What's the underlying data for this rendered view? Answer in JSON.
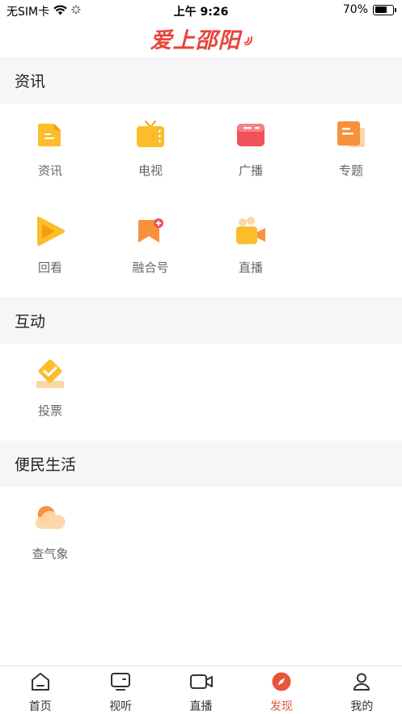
{
  "status_bar": {
    "carrier": "无SIM卡",
    "time": "上午 9:26",
    "battery_text": "70%",
    "battery_level": 0.7
  },
  "header": {
    "logo_text": "爱上邵阳"
  },
  "sections": {
    "news": {
      "title": "资讯",
      "items": [
        {
          "label": "资讯",
          "icon": "news-doc-icon"
        },
        {
          "label": "电视",
          "icon": "tv-icon"
        },
        {
          "label": "广播",
          "icon": "radio-icon"
        },
        {
          "label": "专题",
          "icon": "topic-icon"
        },
        {
          "label": "回看",
          "icon": "playback-icon"
        },
        {
          "label": "融合号",
          "icon": "media-account-icon"
        },
        {
          "label": "直播",
          "icon": "live-camera-icon"
        }
      ]
    },
    "interact": {
      "title": "互动",
      "items": [
        {
          "label": "投票",
          "icon": "vote-icon"
        }
      ]
    },
    "service": {
      "title": "便民生活",
      "items": [
        {
          "label": "查气象",
          "icon": "weather-icon"
        }
      ]
    }
  },
  "bottom_nav": [
    {
      "label": "首页",
      "icon": "home-icon"
    },
    {
      "label": "视听",
      "icon": "tv-screen-icon"
    },
    {
      "label": "直播",
      "icon": "video-camera-icon"
    },
    {
      "label": "发现",
      "icon": "compass-icon",
      "active": true
    },
    {
      "label": "我的",
      "icon": "user-icon"
    }
  ],
  "colors": {
    "accent": "#e8553a",
    "logo_red": "#e8443a",
    "icon_orange": "#f9a825",
    "icon_red": "#f0525a"
  }
}
